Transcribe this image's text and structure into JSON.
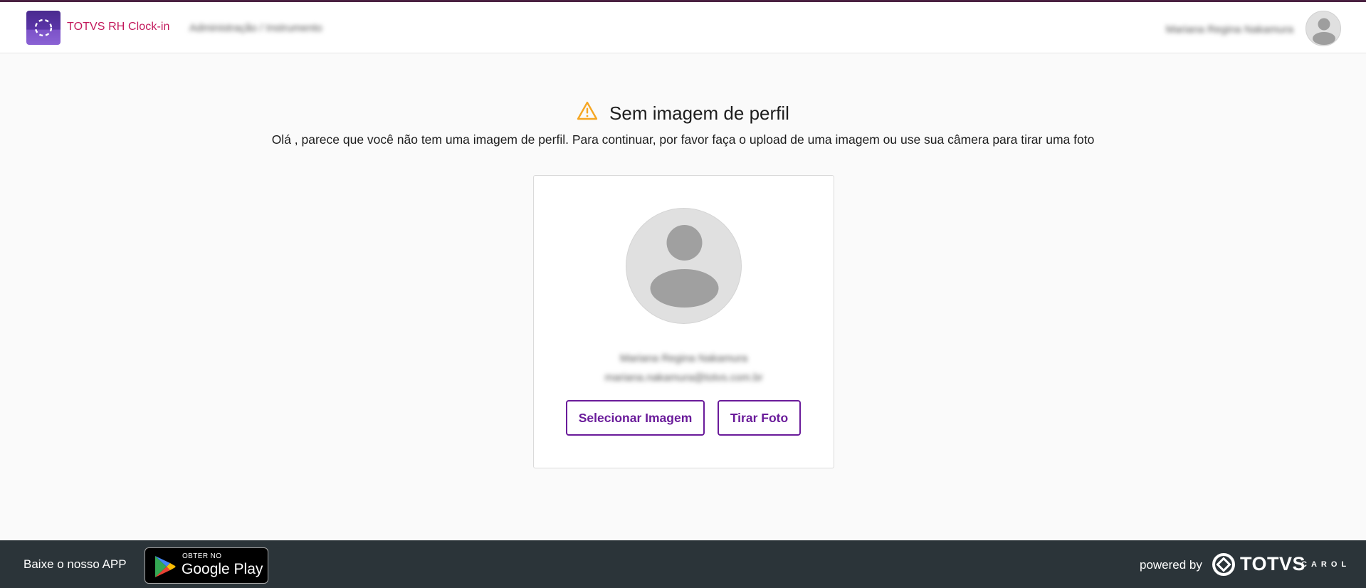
{
  "header": {
    "app_title": "TOTVS RH Clock-in",
    "breadcrumb": "Administração / Instrumento",
    "user_name": "Mariana Regina Nakamura"
  },
  "main": {
    "title": "Sem imagem de perfil",
    "subtitle": "Olá , parece que você não tem uma imagem de perfil. Para continuar, por favor faça o upload de uma imagem ou use sua câmera para tirar uma foto",
    "card": {
      "name": "Mariana Regina Nakamura",
      "email": "mariana.nakamura@totvs.com.br",
      "select_button": "Selecionar Imagem",
      "photo_button": "Tirar Foto"
    }
  },
  "footer": {
    "app_label": "Baixe o nosso APP",
    "store_small": "OBTER NO",
    "store_big": "Google Play",
    "powered_by": "powered by",
    "brand": "TOTVS",
    "brand_sub": "CAROL"
  },
  "colors": {
    "accent": "#6a1b9a",
    "app_title": "#c2185b",
    "warning": "#f5a623",
    "footer_bg": "#2b3439"
  },
  "icons": [
    "logo-icon",
    "avatar-icon",
    "warning-icon",
    "google-play-icon",
    "totvs-logo-icon"
  ]
}
